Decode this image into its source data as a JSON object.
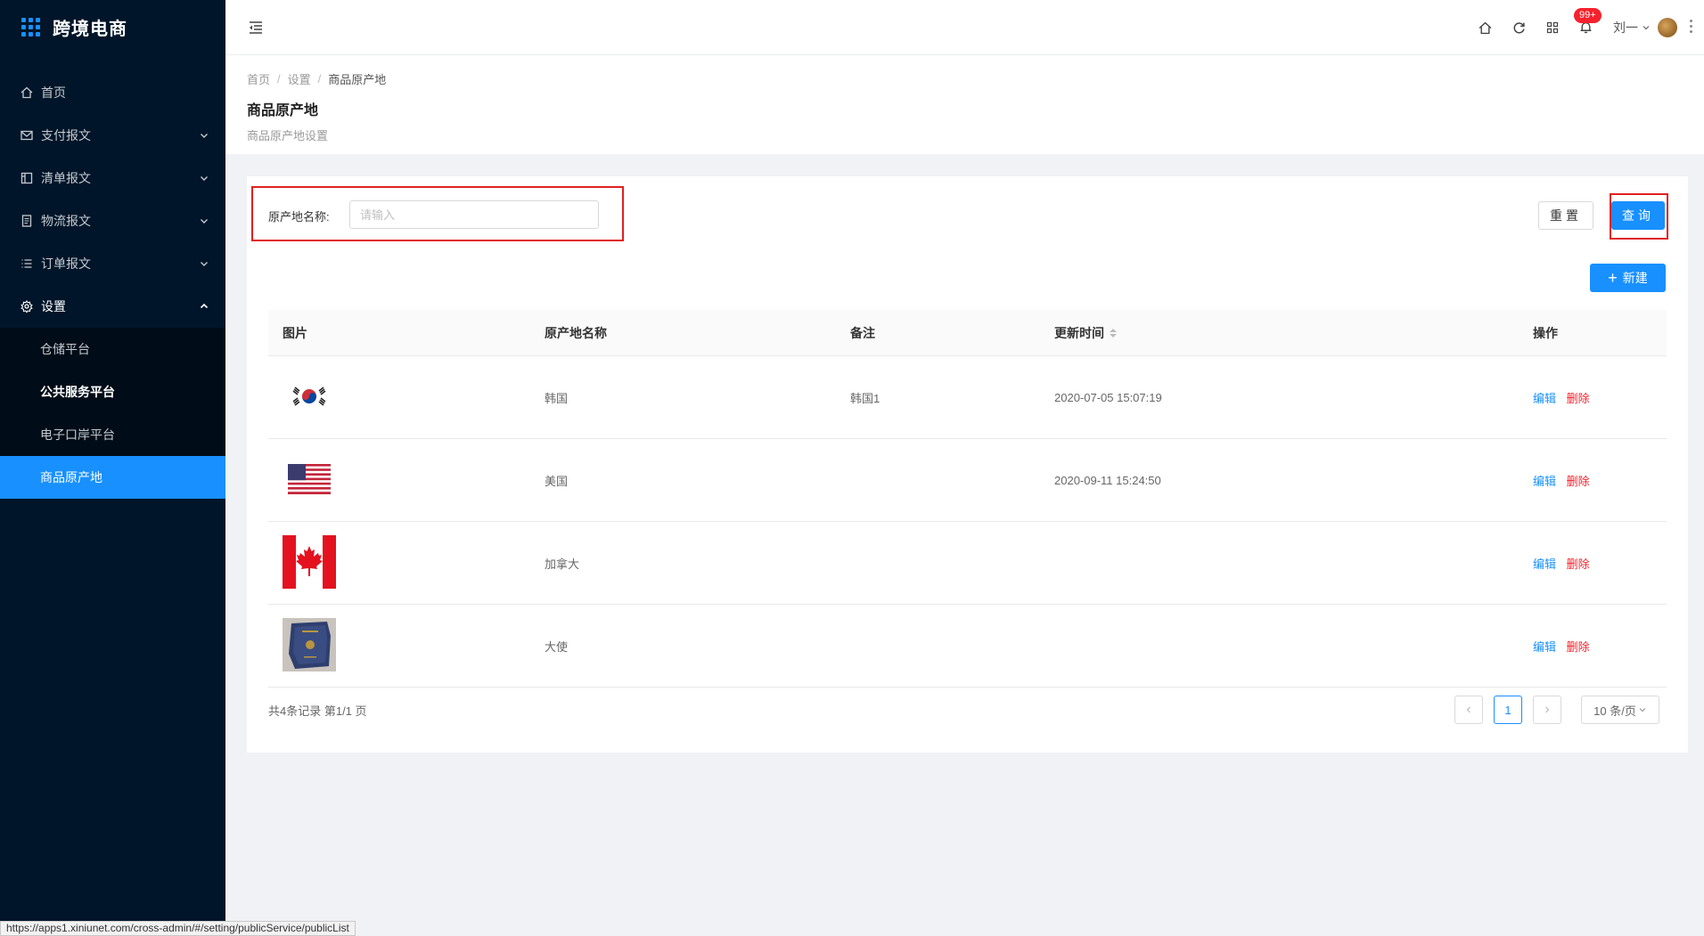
{
  "app": {
    "title": "跨境电商"
  },
  "sidebar": {
    "items": [
      {
        "label": "首页",
        "icon": "home-icon",
        "expandable": false
      },
      {
        "label": "支付报文",
        "icon": "mail-icon",
        "expandable": true
      },
      {
        "label": "清单报文",
        "icon": "list-panel-icon",
        "expandable": true
      },
      {
        "label": "物流报文",
        "icon": "document-icon",
        "expandable": true
      },
      {
        "label": "订单报文",
        "icon": "list-icon",
        "expandable": true
      },
      {
        "label": "设置",
        "icon": "gear-icon",
        "expandable": true,
        "open": true
      }
    ],
    "sub_items": [
      {
        "label": "仓储平台"
      },
      {
        "label": "公共服务平台"
      },
      {
        "label": "电子口岸平台"
      },
      {
        "label": "商品原产地",
        "active": true
      }
    ]
  },
  "header": {
    "badge": "99+",
    "user": "刘一"
  },
  "breadcrumb": {
    "home": "首页",
    "settings": "设置",
    "current": "商品原产地"
  },
  "page": {
    "title": "商品原产地",
    "subtitle": "商品原产地设置"
  },
  "search": {
    "label": "原产地名称:",
    "placeholder": "请输入",
    "reset": "重置",
    "query": "查询",
    "new": "新建"
  },
  "table": {
    "headers": {
      "image": "图片",
      "name": "原产地名称",
      "note": "备注",
      "time": "更新时间",
      "op": "操作"
    },
    "rows": [
      {
        "image": "korea-flag",
        "name": "韩国",
        "note": "韩国1",
        "time": "2020-07-05 15:07:19"
      },
      {
        "image": "usa-flag",
        "name": "美国",
        "note": "",
        "time": "2020-09-11 15:24:50"
      },
      {
        "image": "canada-flag",
        "name": "加拿大",
        "note": "",
        "time": ""
      },
      {
        "image": "passport-photo",
        "name": "大使",
        "note": "",
        "time": ""
      }
    ],
    "edit": "编辑",
    "delete": "删除"
  },
  "pagination": {
    "total": "共4条记录 第1/1 页",
    "page": "1",
    "size": "10 条/页"
  },
  "status_url": "https://apps1.xiniunet.com/cross-admin/#/setting/publicService/publicList",
  "colors": {
    "primary": "#1890ff",
    "sidebar": "#001529",
    "danger": "#f5222d",
    "highlight": "#e02020"
  }
}
